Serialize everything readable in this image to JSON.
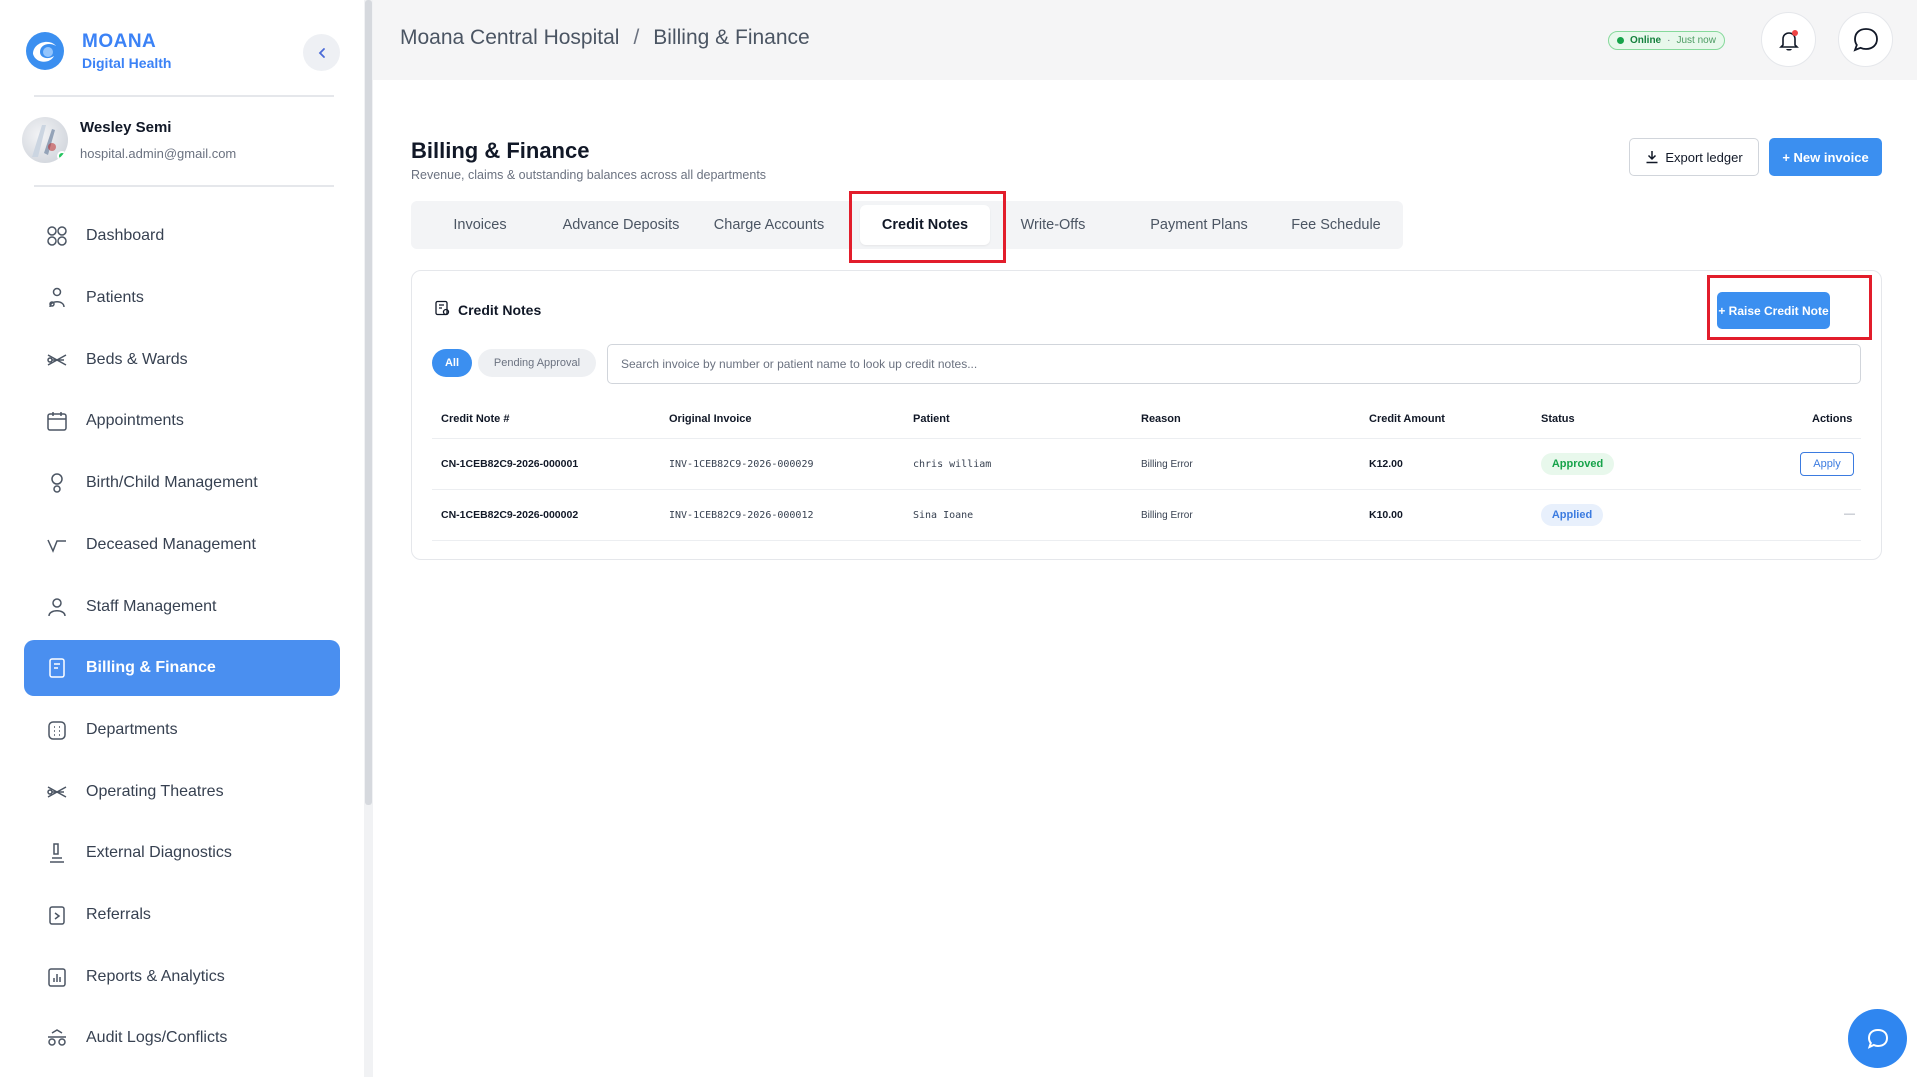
{
  "brand": {
    "name": "MOANA",
    "subtitle": "Digital Health"
  },
  "user": {
    "name": "Wesley Semi",
    "email": "hospital.admin@gmail.com"
  },
  "sidebar": {
    "items": [
      {
        "label": "Dashboard",
        "icon": "dashboard-icon"
      },
      {
        "label": "Patients",
        "icon": "patients-icon"
      },
      {
        "label": "Beds & Wards",
        "icon": "bed-icon"
      },
      {
        "label": "Appointments",
        "icon": "calendar-icon"
      },
      {
        "label": "Birth/Child Management",
        "icon": "birth-icon"
      },
      {
        "label": "Deceased Management",
        "icon": "deceased-icon"
      },
      {
        "label": "Staff Management",
        "icon": "staff-icon"
      },
      {
        "label": "Billing & Finance",
        "icon": "billing-icon",
        "active": true
      },
      {
        "label": "Departments",
        "icon": "departments-icon"
      },
      {
        "label": "Operating Theatres",
        "icon": "theatre-icon"
      },
      {
        "label": "External Diagnostics",
        "icon": "microscope-icon"
      },
      {
        "label": "Referrals",
        "icon": "referral-icon"
      },
      {
        "label": "Reports & Analytics",
        "icon": "analytics-icon"
      },
      {
        "label": "Audit Logs/Conflicts",
        "icon": "audit-icon"
      }
    ]
  },
  "header": {
    "breadcrumb": {
      "hospital": "Moana Central Hospital",
      "separator": "/",
      "section": "Billing & Finance"
    },
    "status": {
      "state": "Online",
      "separator": "·",
      "updated": "Just now"
    }
  },
  "main": {
    "title": "Billing & Finance",
    "subtitle": "Revenue, claims & outstanding balances across all departments",
    "export_label": "Export ledger",
    "new_invoice_label": "+ New invoice",
    "tabs": [
      {
        "label": "Invoices"
      },
      {
        "label": "Advance Deposits"
      },
      {
        "label": "Charge Accounts"
      },
      {
        "label": "Credit Notes",
        "active": true
      },
      {
        "label": "Write-Offs"
      },
      {
        "label": "Payment Plans"
      },
      {
        "label": "Fee Schedule"
      }
    ]
  },
  "credit_notes": {
    "title": "Credit Notes",
    "raise_label": "+ Raise Credit Note",
    "filters": {
      "all": "All",
      "pending": "Pending Approval"
    },
    "search_placeholder": "Search invoice by number or patient name to look up credit notes...",
    "columns": [
      "Credit Note #",
      "Original Invoice",
      "Patient",
      "Reason",
      "Credit Amount",
      "Status",
      "Actions"
    ],
    "rows": [
      {
        "credit_note": "CN-1CEB82C9-2026-000001",
        "invoice": "INV-1CEB82C9-2026-000029",
        "patient": "chris william",
        "reason": "Billing Error",
        "amount": "K12.00",
        "status": "Approved",
        "action": "Apply"
      },
      {
        "credit_note": "CN-1CEB82C9-2026-000002",
        "invoice": "INV-1CEB82C9-2026-000012",
        "patient": "Sina Ioane",
        "reason": "Billing Error",
        "amount": "K10.00",
        "status": "Applied",
        "action": "—"
      }
    ]
  },
  "colors": {
    "accent": "#3b8ff0",
    "highlight": "#e21d2b",
    "online": "#16a34a"
  }
}
